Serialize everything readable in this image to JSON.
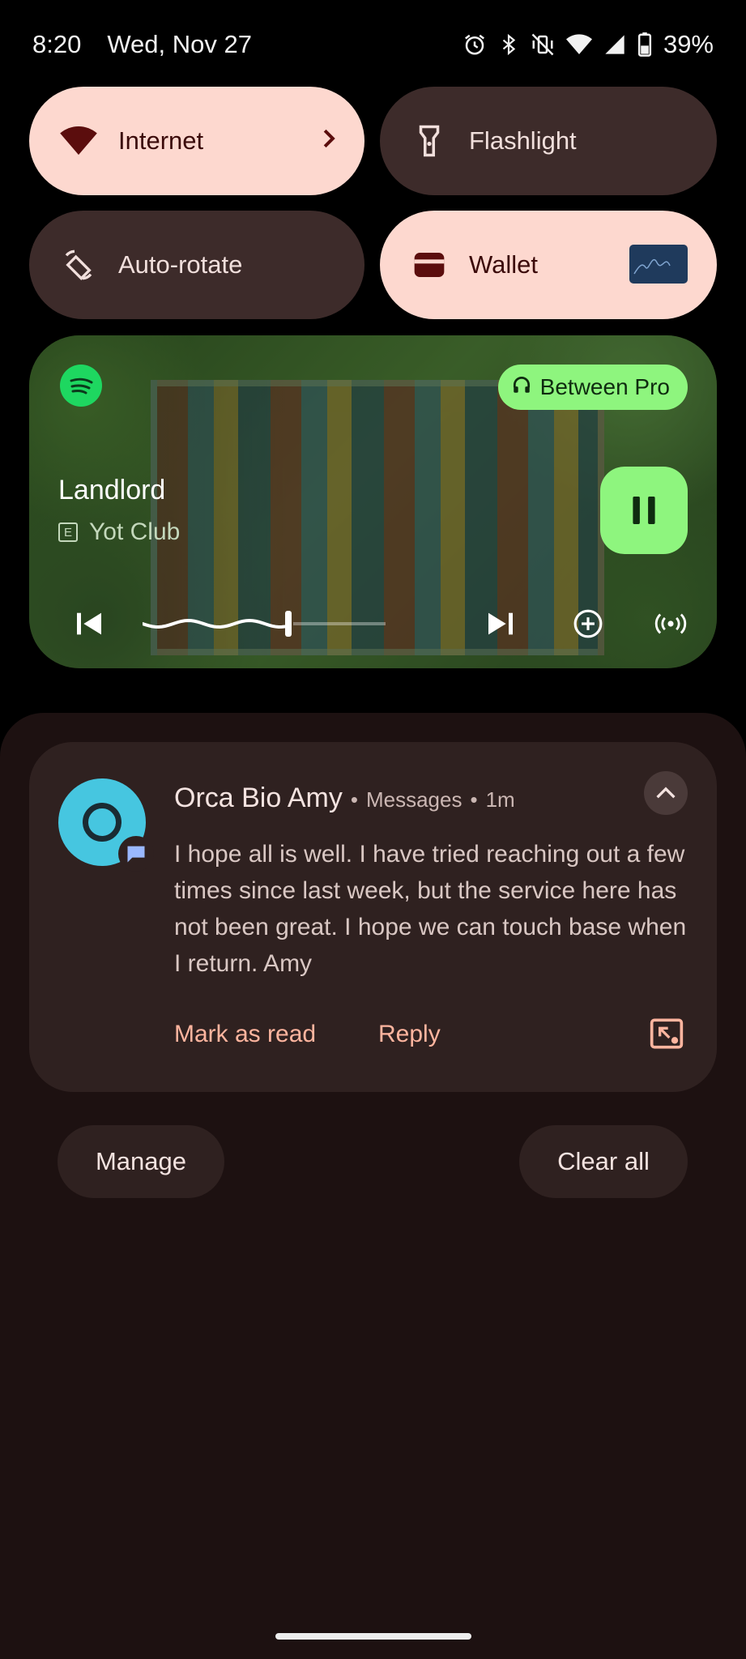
{
  "status_bar": {
    "time": "8:20",
    "date": "Wed, Nov 27",
    "battery": "39%",
    "icons": [
      "alarm-icon",
      "bluetooth-icon",
      "vibrate-off-icon",
      "wifi-icon",
      "cell-signal-icon",
      "battery-icon"
    ]
  },
  "quick_settings": {
    "tiles": [
      {
        "label": "Internet",
        "state": "on",
        "icon": "wifi-icon"
      },
      {
        "label": "Flashlight",
        "state": "off",
        "icon": "flashlight-icon"
      },
      {
        "label": "Auto-rotate",
        "state": "off",
        "icon": "rotate-icon"
      },
      {
        "label": "Wallet",
        "state": "on",
        "icon": "wallet-icon"
      }
    ]
  },
  "media": {
    "app": "Spotify",
    "title": "Landlord",
    "artist": "Yot Club",
    "explicit": "E",
    "output_device": "Between Pro",
    "progress": 0.6,
    "accent": "#8ef57e"
  },
  "notification": {
    "sender": "Orca Bio Amy",
    "app": "Messages",
    "time": "1m",
    "separator": "•",
    "message": "I hope all is well. I have tried reaching out a few times since last week, but the service here has not been great. I hope we can touch base when I return. Amy",
    "actions": {
      "mark_read": "Mark as read",
      "reply": "Reply"
    },
    "avatar_color": "#46c6e0"
  },
  "footer": {
    "manage": "Manage",
    "clear_all": "Clear all"
  },
  "colors": {
    "tile_on": "#fdd8cf",
    "tile_off": "#3d2b2a",
    "shade_bg": "#1d1111",
    "card_bg": "#2f2120",
    "action_text": "#ffb59f"
  }
}
